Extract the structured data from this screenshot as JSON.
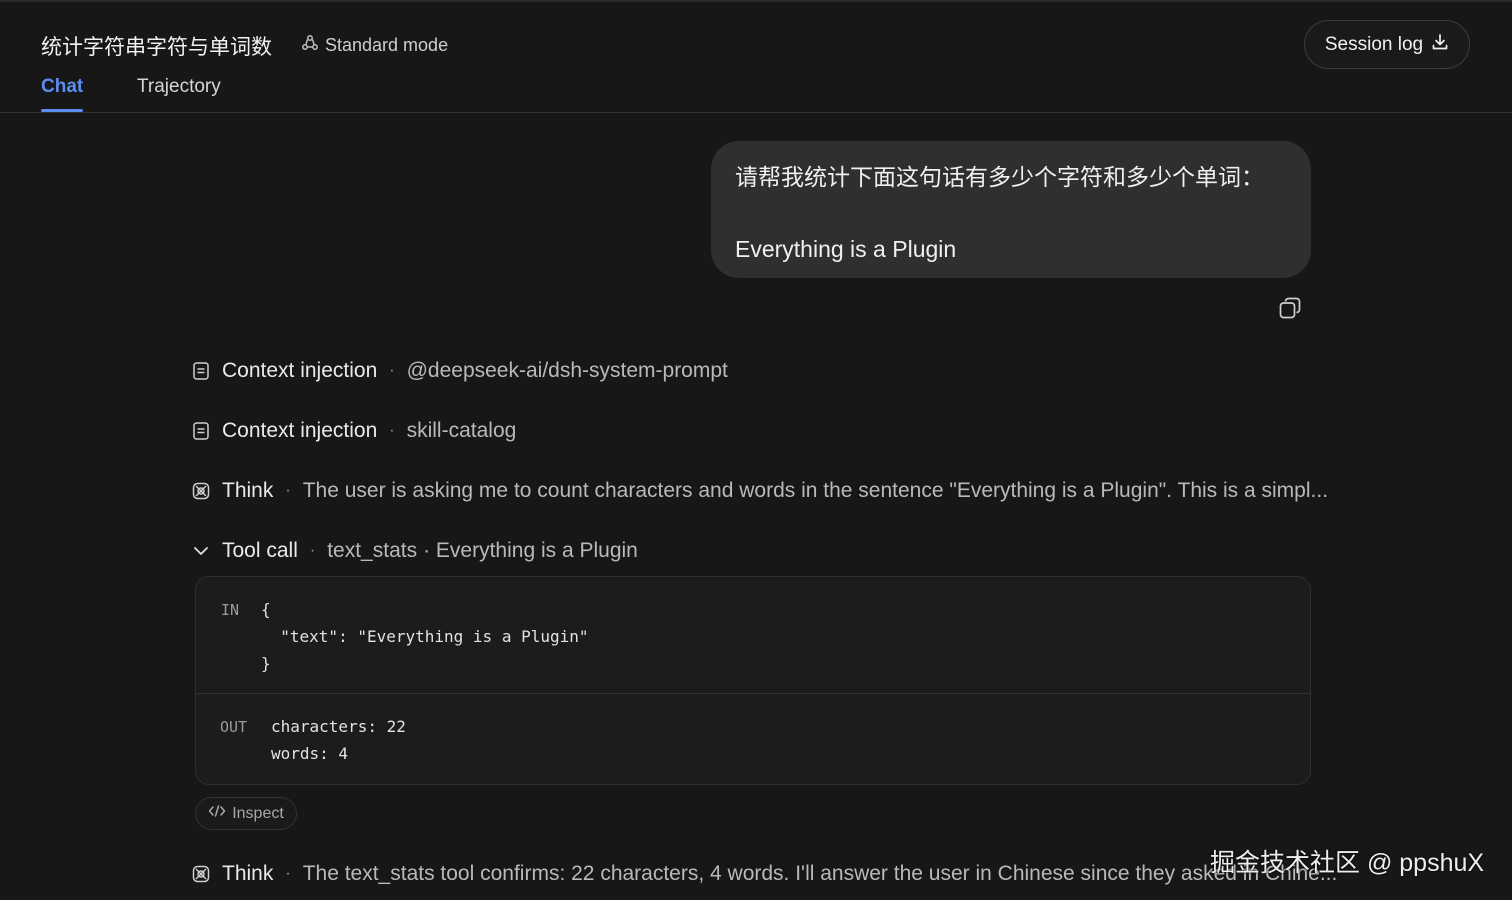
{
  "header": {
    "title": "统计字符串字符与单词数",
    "mode_label": "Standard mode",
    "session_log_label": "Session log",
    "tabs": [
      {
        "label": "Chat",
        "active": true
      },
      {
        "label": "Trajectory",
        "active": false
      }
    ]
  },
  "user_message": {
    "line1": "请帮我统计下面这句话有多少个字符和多少个单词：",
    "line2": "Everything is a Plugin"
  },
  "steps": [
    {
      "label": "Context injection",
      "detail": "@deepseek-ai/dsh-system-prompt",
      "icon": "document-icon"
    },
    {
      "label": "Context injection",
      "detail": "skill-catalog",
      "icon": "document-icon"
    },
    {
      "label": "Think",
      "detail": "The user is asking me to count characters and words in the sentence \"Everything is a Plugin\". This is a simpl...",
      "icon": "brain-icon"
    },
    {
      "label": "Tool call",
      "detail": "text_stats",
      "detail2": "· Everything is a Plugin",
      "icon": "chevron-down-icon"
    },
    {
      "label": "Think",
      "detail": "The text_stats tool confirms: 22 characters, 4 words. I'll answer the user in Chinese since they asked in Chine...",
      "icon": "brain-icon"
    }
  ],
  "tool_call": {
    "in_label": "IN",
    "in_lines": [
      "{",
      "  \"text\": \"Everything is a Plugin\"",
      "}"
    ],
    "out_label": "OUT",
    "out_lines": [
      "characters: 22",
      "words: 4"
    ]
  },
  "inspect_label": "Inspect",
  "watermark": "掘金技术社区 @ ppshuX",
  "colors": {
    "background": "#171717",
    "accent": "#5b8def",
    "bubble": "#2f2f2f"
  }
}
